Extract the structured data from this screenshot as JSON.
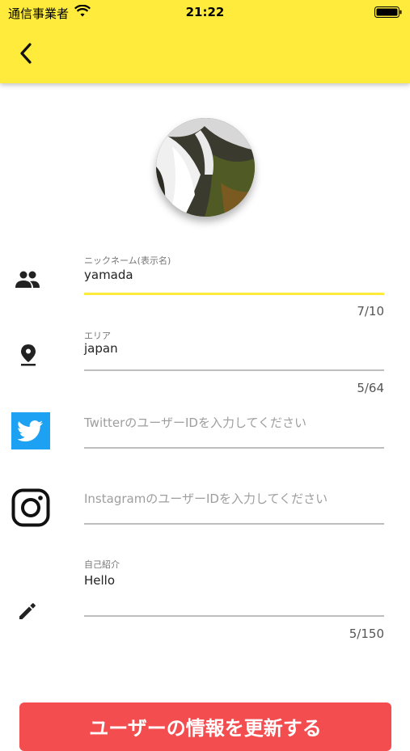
{
  "status_bar": {
    "carrier": "通信事業者",
    "time": "21:22"
  },
  "profile_form": {
    "nickname": {
      "label": "ニックネーム(表示名)",
      "value": "yamada",
      "counter": "7/10"
    },
    "area": {
      "label": "エリア",
      "value": "japan",
      "counter": "5/64"
    },
    "twitter": {
      "placeholder": "TwitterのユーザーIDを入力してください"
    },
    "instagram": {
      "placeholder": "InstagramのユーザーIDを入力してください"
    },
    "bio": {
      "label": "自己紹介",
      "value": "Hello",
      "counter": "5/150"
    }
  },
  "submit": {
    "label": "ユーザーの情報を更新する"
  },
  "colors": {
    "header": "#ffeb3b",
    "accent_underline": "#ffeb3b",
    "twitter": "#1da1f2",
    "submit": "#f44d50"
  },
  "icons": [
    "wifi-icon",
    "battery-icon",
    "back-arrow-icon",
    "people-icon",
    "location-pin-icon",
    "twitter-icon",
    "instagram-icon",
    "pencil-icon"
  ]
}
